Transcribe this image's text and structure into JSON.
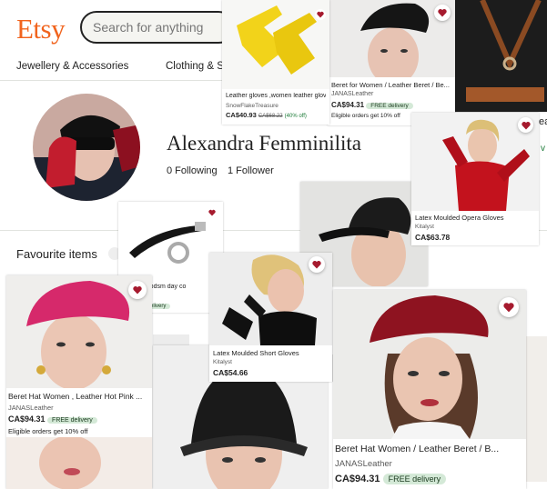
{
  "logo": "Etsy",
  "search": {
    "placeholder": "Search for anything"
  },
  "nav": [
    "Jewellery & Accessories",
    "Clothing & S"
  ],
  "profile": {
    "name": "Alexandra Femminilita",
    "following": "0 Following",
    "followers": "1 Follower"
  },
  "favourites_title": "Favourite items",
  "edge_fragments": [
    "ea",
    "v"
  ],
  "cards": {
    "gloves": {
      "title": "Leather gloves ,women leather glove...",
      "shop": "SnowFlakeTreasure",
      "price": "CA$40.93",
      "old_price": "CA$68.22",
      "discount": "(40% off)"
    },
    "beret_top": {
      "title": "Beret for Women / Leather Beret / Be...",
      "shop": "JANASLeather",
      "price": "CA$94.31",
      "delivery": "FREE delivery",
      "note": "Eligible orders get 10% off"
    },
    "opera": {
      "title": "Latex Moulded Opera Gloves",
      "shop": "Kitalyst",
      "price": "CA$63.78"
    },
    "collar": {
      "title": "t Collar, bdsm day co",
      "shop": "ore",
      "delivery": "FREE delivery"
    },
    "short_gloves": {
      "title": "Latex Moulded Short Gloves",
      "shop": "Kitalyst",
      "price": "CA$54.66"
    },
    "pink_beret": {
      "title": "Beret Hat Women , Leather Hot Pink ...",
      "shop": "JANASLeather",
      "price": "CA$94.31",
      "delivery": "FREE delivery",
      "note": "Eligible orders get 10% off"
    },
    "red_beret": {
      "title": "Beret Hat Women / Leather Beret / B...",
      "shop": "JANASLeather",
      "price": "CA$94.31",
      "delivery": "FREE delivery"
    }
  },
  "colors": {
    "brand": "#f1641e",
    "heart": "#a61a2e",
    "delivery_badge": "#d4e9d7"
  }
}
